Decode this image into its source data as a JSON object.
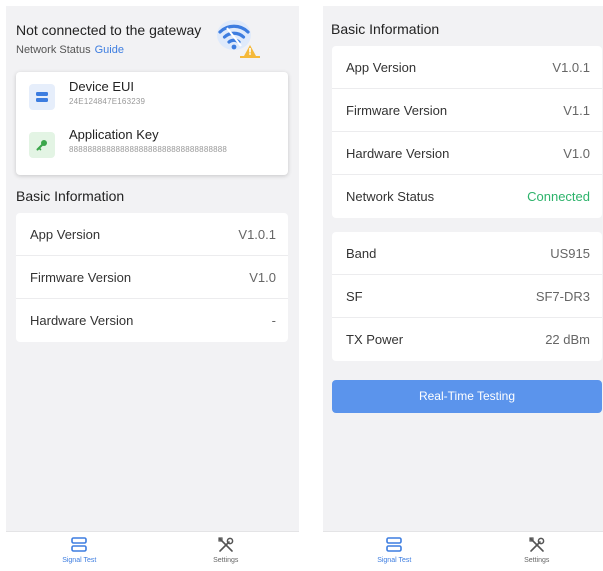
{
  "left": {
    "status": {
      "title": "Not connected to the gateway",
      "network_status_label": "Network Status",
      "guide_label": "Guide"
    },
    "keys": [
      {
        "label": "Device EUI",
        "value": "24E124847E163239",
        "icon": "server-icon"
      },
      {
        "label": "Application Key",
        "value": "8888888888888888888888888888888888",
        "icon": "key-icon"
      }
    ],
    "basic_info": {
      "title": "Basic Information",
      "rows": [
        {
          "label": "App Version",
          "value": "V1.0.1"
        },
        {
          "label": "Firmware Version",
          "value": "V1.0"
        },
        {
          "label": "Hardware Version",
          "value": "-"
        }
      ]
    }
  },
  "right": {
    "basic_info": {
      "title": "Basic Information",
      "rows": [
        {
          "label": "App Version",
          "value": "V1.0.1"
        },
        {
          "label": "Firmware Version",
          "value": "V1.1"
        },
        {
          "label": "Hardware Version",
          "value": "V1.0"
        },
        {
          "label": "Network Status",
          "value": "Connected"
        }
      ]
    },
    "radio": {
      "rows": [
        {
          "label": "Band",
          "value": "US915"
        },
        {
          "label": "SF",
          "value": "SF7-DR3"
        },
        {
          "label": "TX Power",
          "value": "22 dBm"
        }
      ]
    },
    "test_button_label": "Real-Time Testing"
  },
  "tabs": [
    {
      "label": "Signal Test",
      "icon": "signal-test-icon",
      "active": true
    },
    {
      "label": "Settings",
      "icon": "settings-tools-icon",
      "active": false
    }
  ],
  "colors": {
    "accent": "#3d7de0",
    "button": "#5b94ec",
    "connected": "#2db36b",
    "background": "#f2f2f4"
  }
}
